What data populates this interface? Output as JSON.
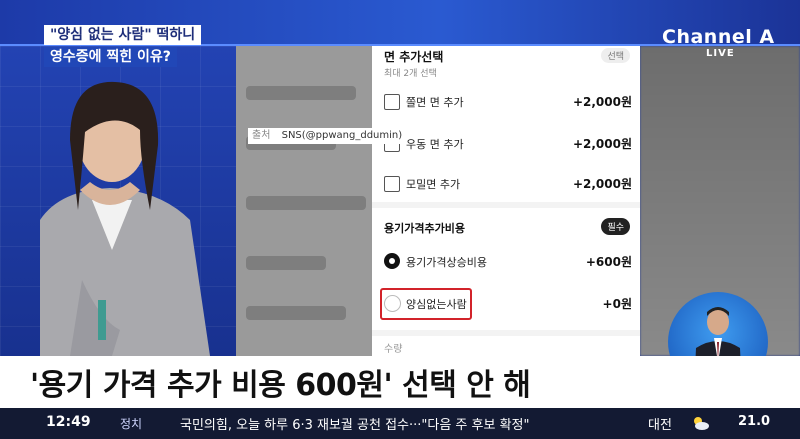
{
  "broadcast": {
    "question_line1": "\"양심 없는 사람\" 떡하니",
    "question_line2": "영수증에 찍힌 이유?",
    "logo": "Channel A",
    "live": "LIVE",
    "source_label": "출처",
    "source_value": "SNS(@ppwang_ddumin)"
  },
  "phone": {
    "section1_title": "면 추가선택",
    "section1_sub": "최대 2개 선택",
    "section1_badge": "선택",
    "noodle_options": [
      {
        "label": "쫄면 면 추가",
        "price": "+2,000원"
      },
      {
        "label": "우동 면 추가",
        "price": "+2,000원"
      },
      {
        "label": "모밀면 추가",
        "price": "+2,000원"
      }
    ],
    "section2_title": "용기가격추가비용",
    "section2_badge": "필수",
    "container_options": [
      {
        "label": "용기가격상승비용",
        "price": "+600원",
        "selected": true
      },
      {
        "label": "양심없는사람",
        "price": "+0원",
        "selected": false
      }
    ],
    "section3_title": "수량"
  },
  "lower_third": {
    "headline": "'용기 가격 추가 비용 600원' 선택 안 해"
  },
  "ticker": {
    "time": "12:49",
    "category": "정치",
    "text": "국민의힘, 오늘 하루 6·3 재보궐 공천 접수···\"다음 주 후보 확정\"",
    "city": "대전",
    "temperature": "21.0",
    "weather_icon": "partly-cloudy-icon"
  },
  "colors": {
    "brand_blue": "#2147b7",
    "highlight_red": "#d2232a",
    "ticker_bg": "#131a33"
  }
}
